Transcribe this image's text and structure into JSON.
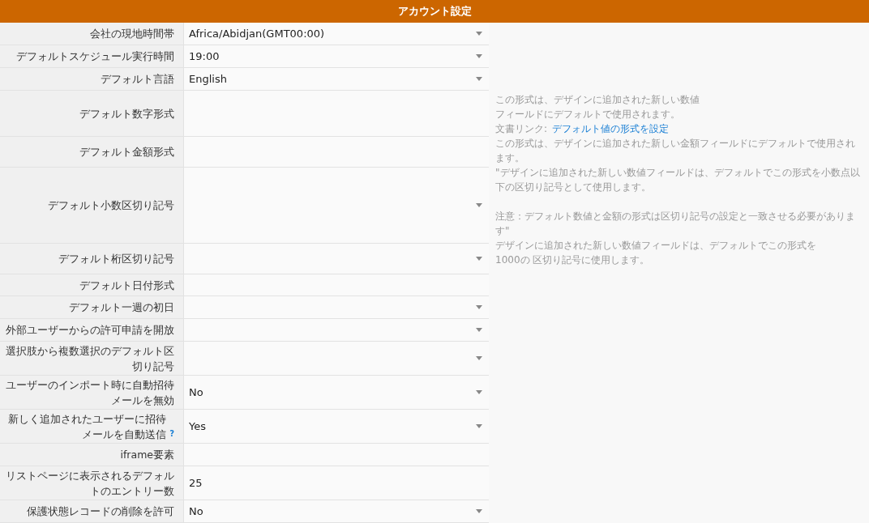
{
  "header": {
    "title": "アカウント設定"
  },
  "rows": [
    {
      "label": "会社の現地時間帯",
      "kind": "select",
      "value": "Africa/Abidjan(GMT00:00)"
    },
    {
      "label": "デフォルトスケジュール実行時間",
      "kind": "select",
      "value": "19:00"
    },
    {
      "label": "デフォルト言語",
      "kind": "select",
      "value": "English"
    },
    {
      "label": "デフォルト数字形式",
      "kind": "text"
    },
    {
      "label": "デフォルト金額形式",
      "kind": "text"
    },
    {
      "label": "デフォルト小数区切り記号",
      "kind": "select"
    },
    {
      "label": "デフォルト桁区切り記号",
      "kind": "select"
    },
    {
      "label": "デフォルト日付形式",
      "kind": "text"
    },
    {
      "label": "デフォルト一週の初日",
      "kind": "select"
    },
    {
      "label": "外部ユーザーからの許可申請を開放",
      "kind": "select"
    },
    {
      "label": "選択肢から複数選択のデフォルト区切り記号",
      "kind": "select"
    },
    {
      "label": "ユーザーのインポート時に自動招待メールを無効",
      "kind": "select",
      "value": "No"
    },
    {
      "label": "新しく追加されたユーザーに招待メールを自動送信",
      "help": "?",
      "kind": "select",
      "value": "Yes"
    },
    {
      "label": "iframe要素",
      "kind": "text"
    },
    {
      "label": "リストページに表示されるデフォルトのエントリー数",
      "kind": "text",
      "value": "25"
    },
    {
      "label": "保護状態レコードの削除を許可",
      "kind": "select",
      "value": "No"
    }
  ],
  "help": [
    {
      "kind": "note",
      "text": "この形式は、デザインに追加された新しい数値"
    },
    {
      "kind": "note",
      "text": "フィールドにデフォルトで使用されます。"
    },
    {
      "kind": "link",
      "label": "文書リンク:",
      "link": "デフォルト値の形式を設定"
    },
    {
      "kind": "note",
      "text": "この形式は、デザインに追加された新しい金額フィールドにデフォルトで使用されます。"
    },
    {
      "kind": "note",
      "text": "\"デザインに追加された新しい数値フィールドは、デフォルトでこの形式を小数点以下の区切り記号として使用します。"
    },
    {
      "kind": "note",
      "text": "注意：デフォルト数値と金額の形式は区切り記号の設定と一致させる必要があります\""
    },
    {
      "kind": "note",
      "text": "デザインに追加された新しい数値フィールドは、デフォルトでこの形式を"
    },
    {
      "kind": "note",
      "text": "1000の 区切り記号に使用します。"
    }
  ]
}
